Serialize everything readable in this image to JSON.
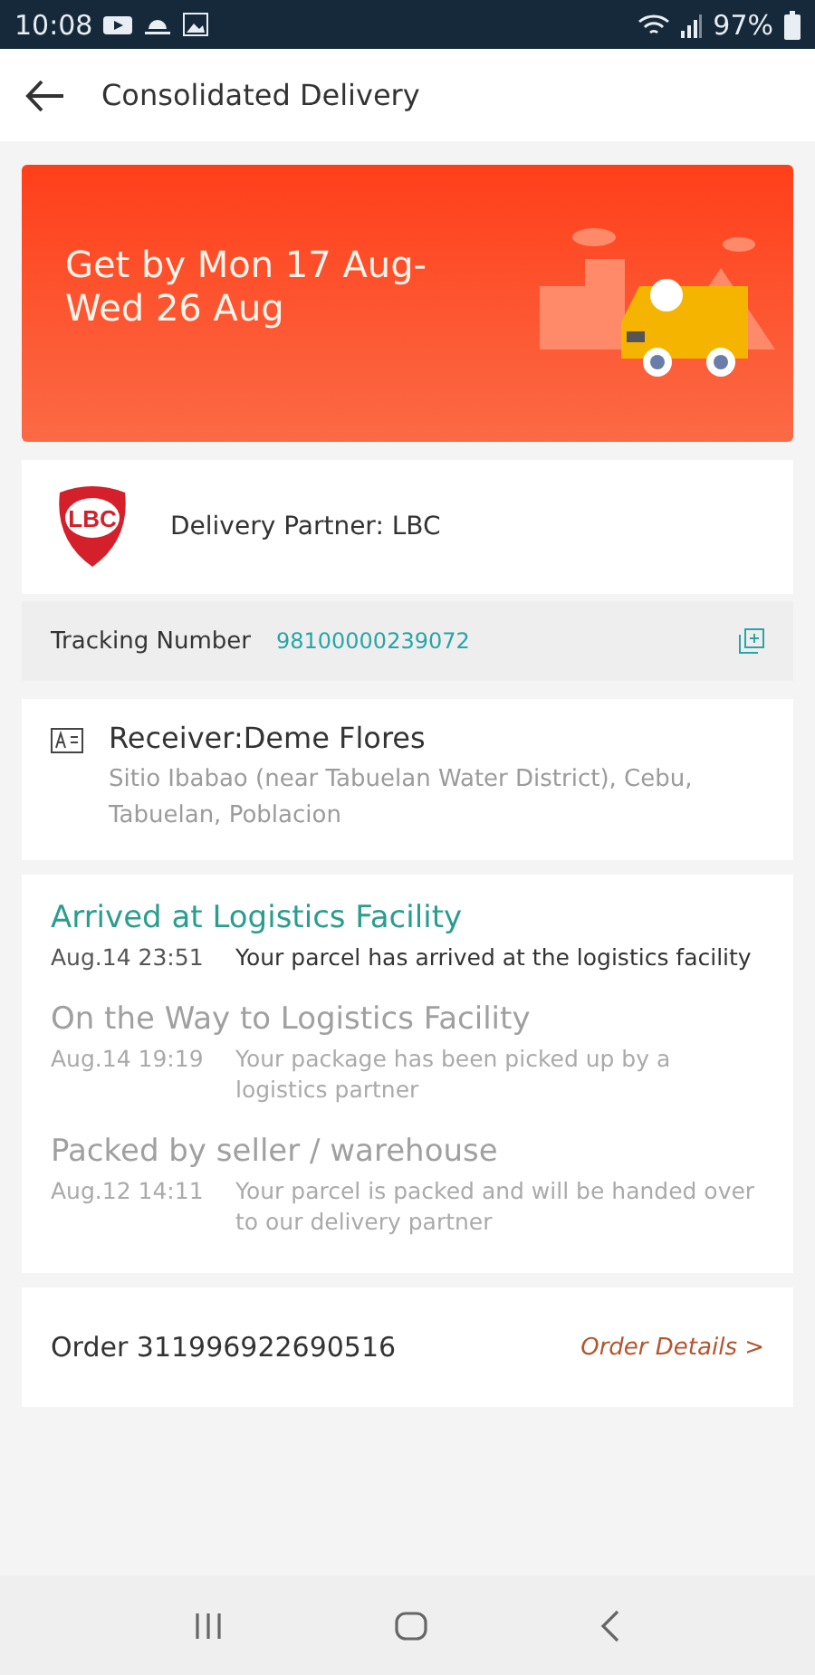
{
  "status_bar": {
    "time": "10:08",
    "battery": "97%"
  },
  "header": {
    "title": "Consolidated Delivery"
  },
  "banner": {
    "text": "Get by Mon 17 Aug-Wed 26 Aug"
  },
  "partner": {
    "logo_text": "LBC",
    "label": "Delivery Partner: LBC"
  },
  "tracking": {
    "label": "Tracking Number",
    "number": "98100000239072"
  },
  "receiver": {
    "name": "Receiver:Deme Flores",
    "address": "Sitio Ibabao (near Tabuelan Water District), Cebu, Tabuelan, Poblacion"
  },
  "timeline": [
    {
      "title": "Arrived at Logistics Facility",
      "time": "Aug.14 23:51",
      "description": "Your parcel has arrived at the logistics facility",
      "current": true
    },
    {
      "title": "On the Way to Logistics Facility",
      "time": "Aug.14 19:19",
      "description": "Your package has been picked up by a logistics partner",
      "current": false
    },
    {
      "title": "Packed by seller / warehouse",
      "time": "Aug.12 14:11",
      "description": "Your parcel is packed and will be handed over to our delivery partner",
      "current": false
    }
  ],
  "order": {
    "label": "Order 311996922690516",
    "link": "Order Details >"
  }
}
